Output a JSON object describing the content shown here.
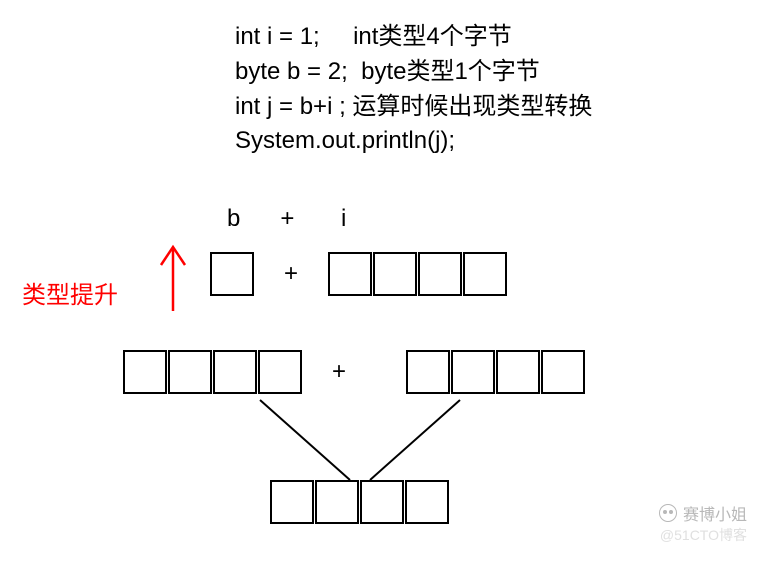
{
  "code": {
    "line1_left": "int i = 1;",
    "line1_right": "int类型4个字节",
    "line2_left": "byte b = 2;",
    "line2_right": "byte类型1个字节",
    "line3_left": "int j = b+i ;",
    "line3_right": "运算时候出现类型转换",
    "line4": "System.out.println(j);"
  },
  "expr_labels": "b      +       i",
  "annotation": {
    "promotion": "类型提升",
    "arrow_color": "#ff0000"
  },
  "plus": "+",
  "byte_boxes_row1": 1,
  "int_boxes_row1": 4,
  "left_boxes_row2": 4,
  "right_boxes_row2": 4,
  "result_boxes_row3": 4,
  "watermark": {
    "name": "赛博小姐",
    "source": "@51CTO博客"
  }
}
